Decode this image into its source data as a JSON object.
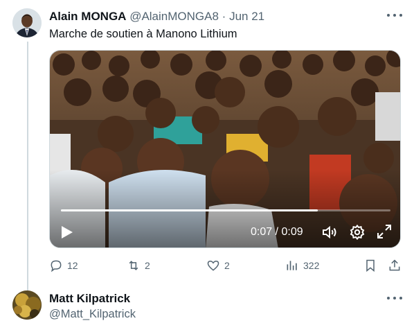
{
  "tweet": {
    "author_name": "Alain MONGA",
    "author_handle": "@AlainMONGA8",
    "separator": "·",
    "date": "Jun 21",
    "text": "Marche de soutien à Manono Lithium",
    "video": {
      "progress": 0.78,
      "time_display": "0:07 / 0:09"
    },
    "actions": {
      "replies": "12",
      "retweets": "2",
      "likes": "2",
      "views": "322"
    }
  },
  "reply": {
    "author_name": "Matt Kilpatrick",
    "author_handle": "@Matt_Kilpatrick"
  },
  "colors": {
    "text_primary": "#0f1419",
    "text_secondary": "#536471",
    "border": "#cfd9de"
  },
  "icons": [
    "more-icon",
    "play-icon",
    "volume-icon",
    "settings-icon",
    "fullscreen-icon",
    "reply-icon",
    "retweet-icon",
    "like-icon",
    "views-icon",
    "bookmark-icon",
    "share-icon"
  ]
}
